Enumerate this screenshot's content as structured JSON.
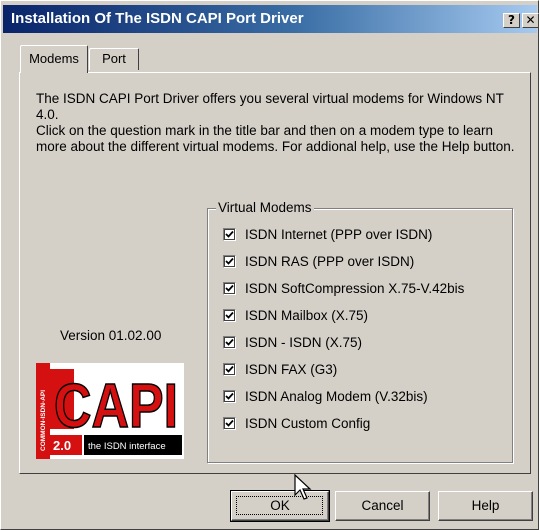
{
  "window": {
    "title": "Installation Of The ISDN CAPI Port Driver",
    "help_glyph": "?",
    "close_glyph": "✕"
  },
  "tabs": [
    {
      "label": "Modems",
      "selected": true
    },
    {
      "label": "Port",
      "selected": false
    }
  ],
  "description": {
    "line1": "The ISDN CAPI Port Driver offers you several virtual modems for Windows NT 4.0.",
    "line2": "Click on the question mark in the title bar and then on a modem type to learn more about the different virtual modems. For addional help, use the Help button."
  },
  "version": "Version 01.02.00",
  "logo": {
    "word": "CAPI",
    "side_text": "COMMON-ISDN-API",
    "version": "2.0",
    "tagline": "the ISDN interface"
  },
  "virtual_modems": {
    "title": "Virtual Modems",
    "items": [
      {
        "label": "ISDN Internet (PPP over ISDN)",
        "checked": true
      },
      {
        "label": "ISDN RAS (PPP over ISDN)",
        "checked": true
      },
      {
        "label": "ISDN SoftCompression X.75-V.42bis",
        "checked": true
      },
      {
        "label": "ISDN Mailbox (X.75)",
        "checked": true
      },
      {
        "label": "ISDN - ISDN (X.75)",
        "checked": true
      },
      {
        "label": "ISDN FAX (G3)",
        "checked": true
      },
      {
        "label": "ISDN Analog Modem (V.32bis)",
        "checked": true
      },
      {
        "label": "ISDN Custom Config",
        "checked": true
      }
    ]
  },
  "buttons": {
    "ok": "OK",
    "cancel": "Cancel",
    "help": "Help"
  },
  "colors": {
    "face": "#d4d0c8",
    "title_start": "#0a246a",
    "title_end": "#a6caf0",
    "logo_red": "#d41010"
  }
}
